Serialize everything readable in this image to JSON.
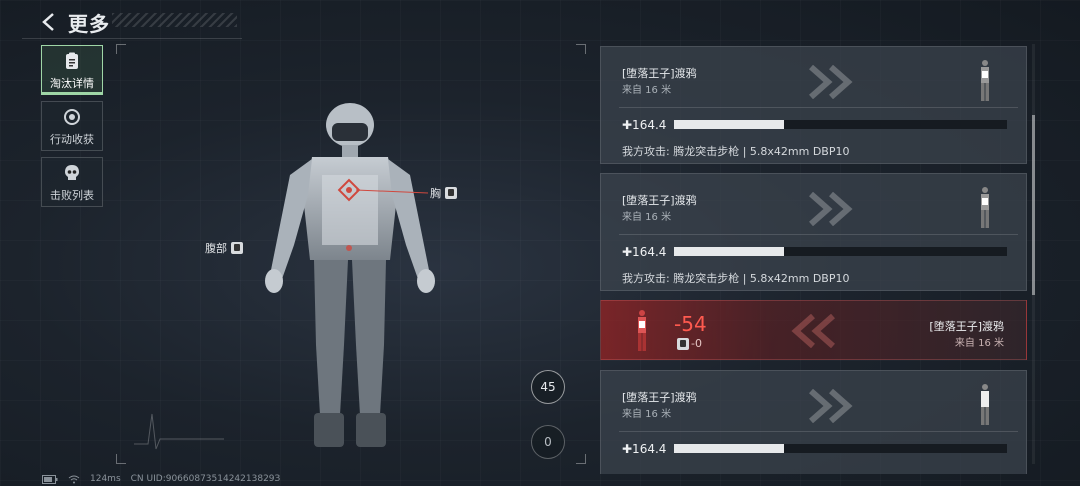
{
  "header": {
    "title": "更多"
  },
  "tabs": [
    {
      "label": "淘汰详情",
      "icon": "report-icon",
      "active": true
    },
    {
      "label": "行动收获",
      "icon": "loot-icon",
      "active": false
    },
    {
      "label": "击败列表",
      "icon": "skull-icon",
      "active": false
    }
  ],
  "figure": {
    "hit_labels": {
      "chest": "胸",
      "abdomen": "腹部"
    },
    "buttons": {
      "top": "45",
      "bottom": "0"
    }
  },
  "cards": [
    {
      "type": "normal",
      "name": "[堕落王子]渡鸦",
      "distance": "来自 16 米",
      "value": "✚164.4",
      "fill": 0.33,
      "attack": "我方攻击: 腾龙突击步枪 | 5.8x42mm DBP10"
    },
    {
      "type": "normal",
      "name": "[堕落王子]渡鸦",
      "distance": "来自 16 米",
      "value": "✚164.4",
      "fill": 0.33,
      "attack": "我方攻击: 腾龙突击步枪 | 5.8x42mm DBP10"
    },
    {
      "type": "hit",
      "name": "[堕落王子]渡鸦",
      "distance": "来自 16 米",
      "damage": "-54",
      "armor": "-0"
    },
    {
      "type": "normal",
      "name": "[堕落王子]渡鸦",
      "distance": "来自 16 米",
      "value": "✚164.4",
      "fill": 0.33,
      "attack": ""
    }
  ],
  "footer": {
    "ping": "124ms",
    "uid": "CN UID:9066087351424213829З"
  }
}
